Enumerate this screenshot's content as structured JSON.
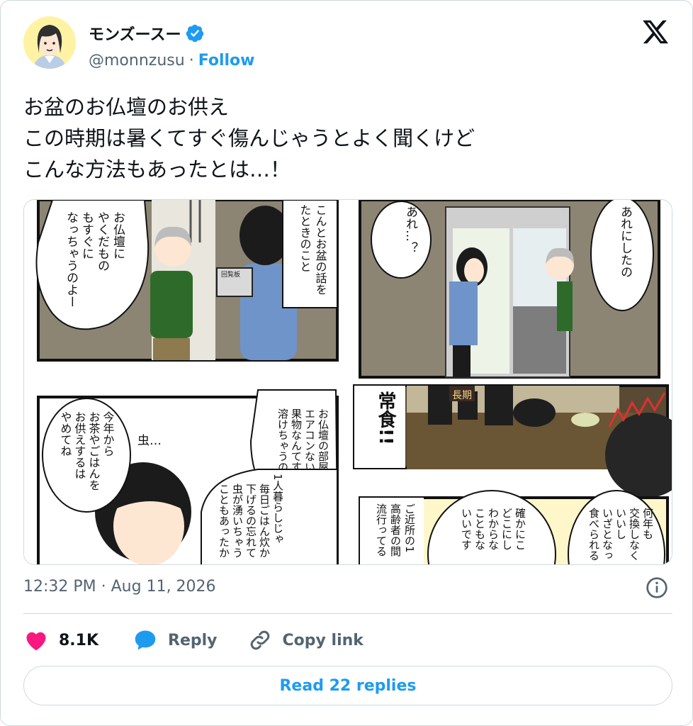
{
  "author": {
    "name": "モンズースー",
    "handle": "@monnzusu",
    "separator": "·",
    "follow_label": "Follow",
    "verified": true
  },
  "tweet": {
    "lines": [
      "お盆のお仏壇のお供え",
      "この時期は暑くてすぐ傷んじゃうとよく聞くけど",
      "こんな方法もあったとは…！"
    ]
  },
  "media": {
    "description_icon": "manga-comic-image",
    "panels": {
      "p1_bubble": [
        "お仏壇に",
        "やくだもの",
        "もすぐに",
        "なっちゃうのよー"
      ],
      "p1_caption": [
        "こんとお盆の話を",
        "たときのこと"
      ],
      "p1_sign": "回覧板",
      "p2_left": "あれ…？",
      "p2_right": "あれにしたの",
      "p3_big": "常食!!",
      "p3_sign": "長期",
      "p4_left": [
        "今年から",
        "お茶やごはんを",
        "お供えするは",
        "やめてね"
      ],
      "p4_sfx": "虫…",
      "p4_center": [
        "お仏壇の部屋",
        "エアコンないから",
        "果物なんてすぐに",
        "溶けちゃうの"
      ],
      "p4_bottom": [
        "1人暮らしじゃ",
        "毎日ごはん炊か",
        "下げるの忘れて",
        "虫が湧いちゃう",
        "こともあったか"
      ],
      "p5_left": [
        "ご近所の1",
        "高齢者の間",
        "流行ってる"
      ],
      "p5_mid": [
        "確かにこ",
        "どこにし",
        "わからな",
        "こともな",
        "いいです"
      ],
      "p5_right": [
        "何年も",
        "交換しなく",
        "いいし",
        "いざとなっ",
        "食べられる"
      ]
    }
  },
  "meta": {
    "timestamp": "12:32 PM · Aug 11, 2026"
  },
  "actions": {
    "likes": "8.1K",
    "reply": "Reply",
    "copy_link": "Copy link"
  },
  "read_replies": "Read 22 replies",
  "colors": {
    "accent": "#1d9bf0",
    "like": "#f91880",
    "muted": "#536471",
    "border": "#cfd9de"
  }
}
